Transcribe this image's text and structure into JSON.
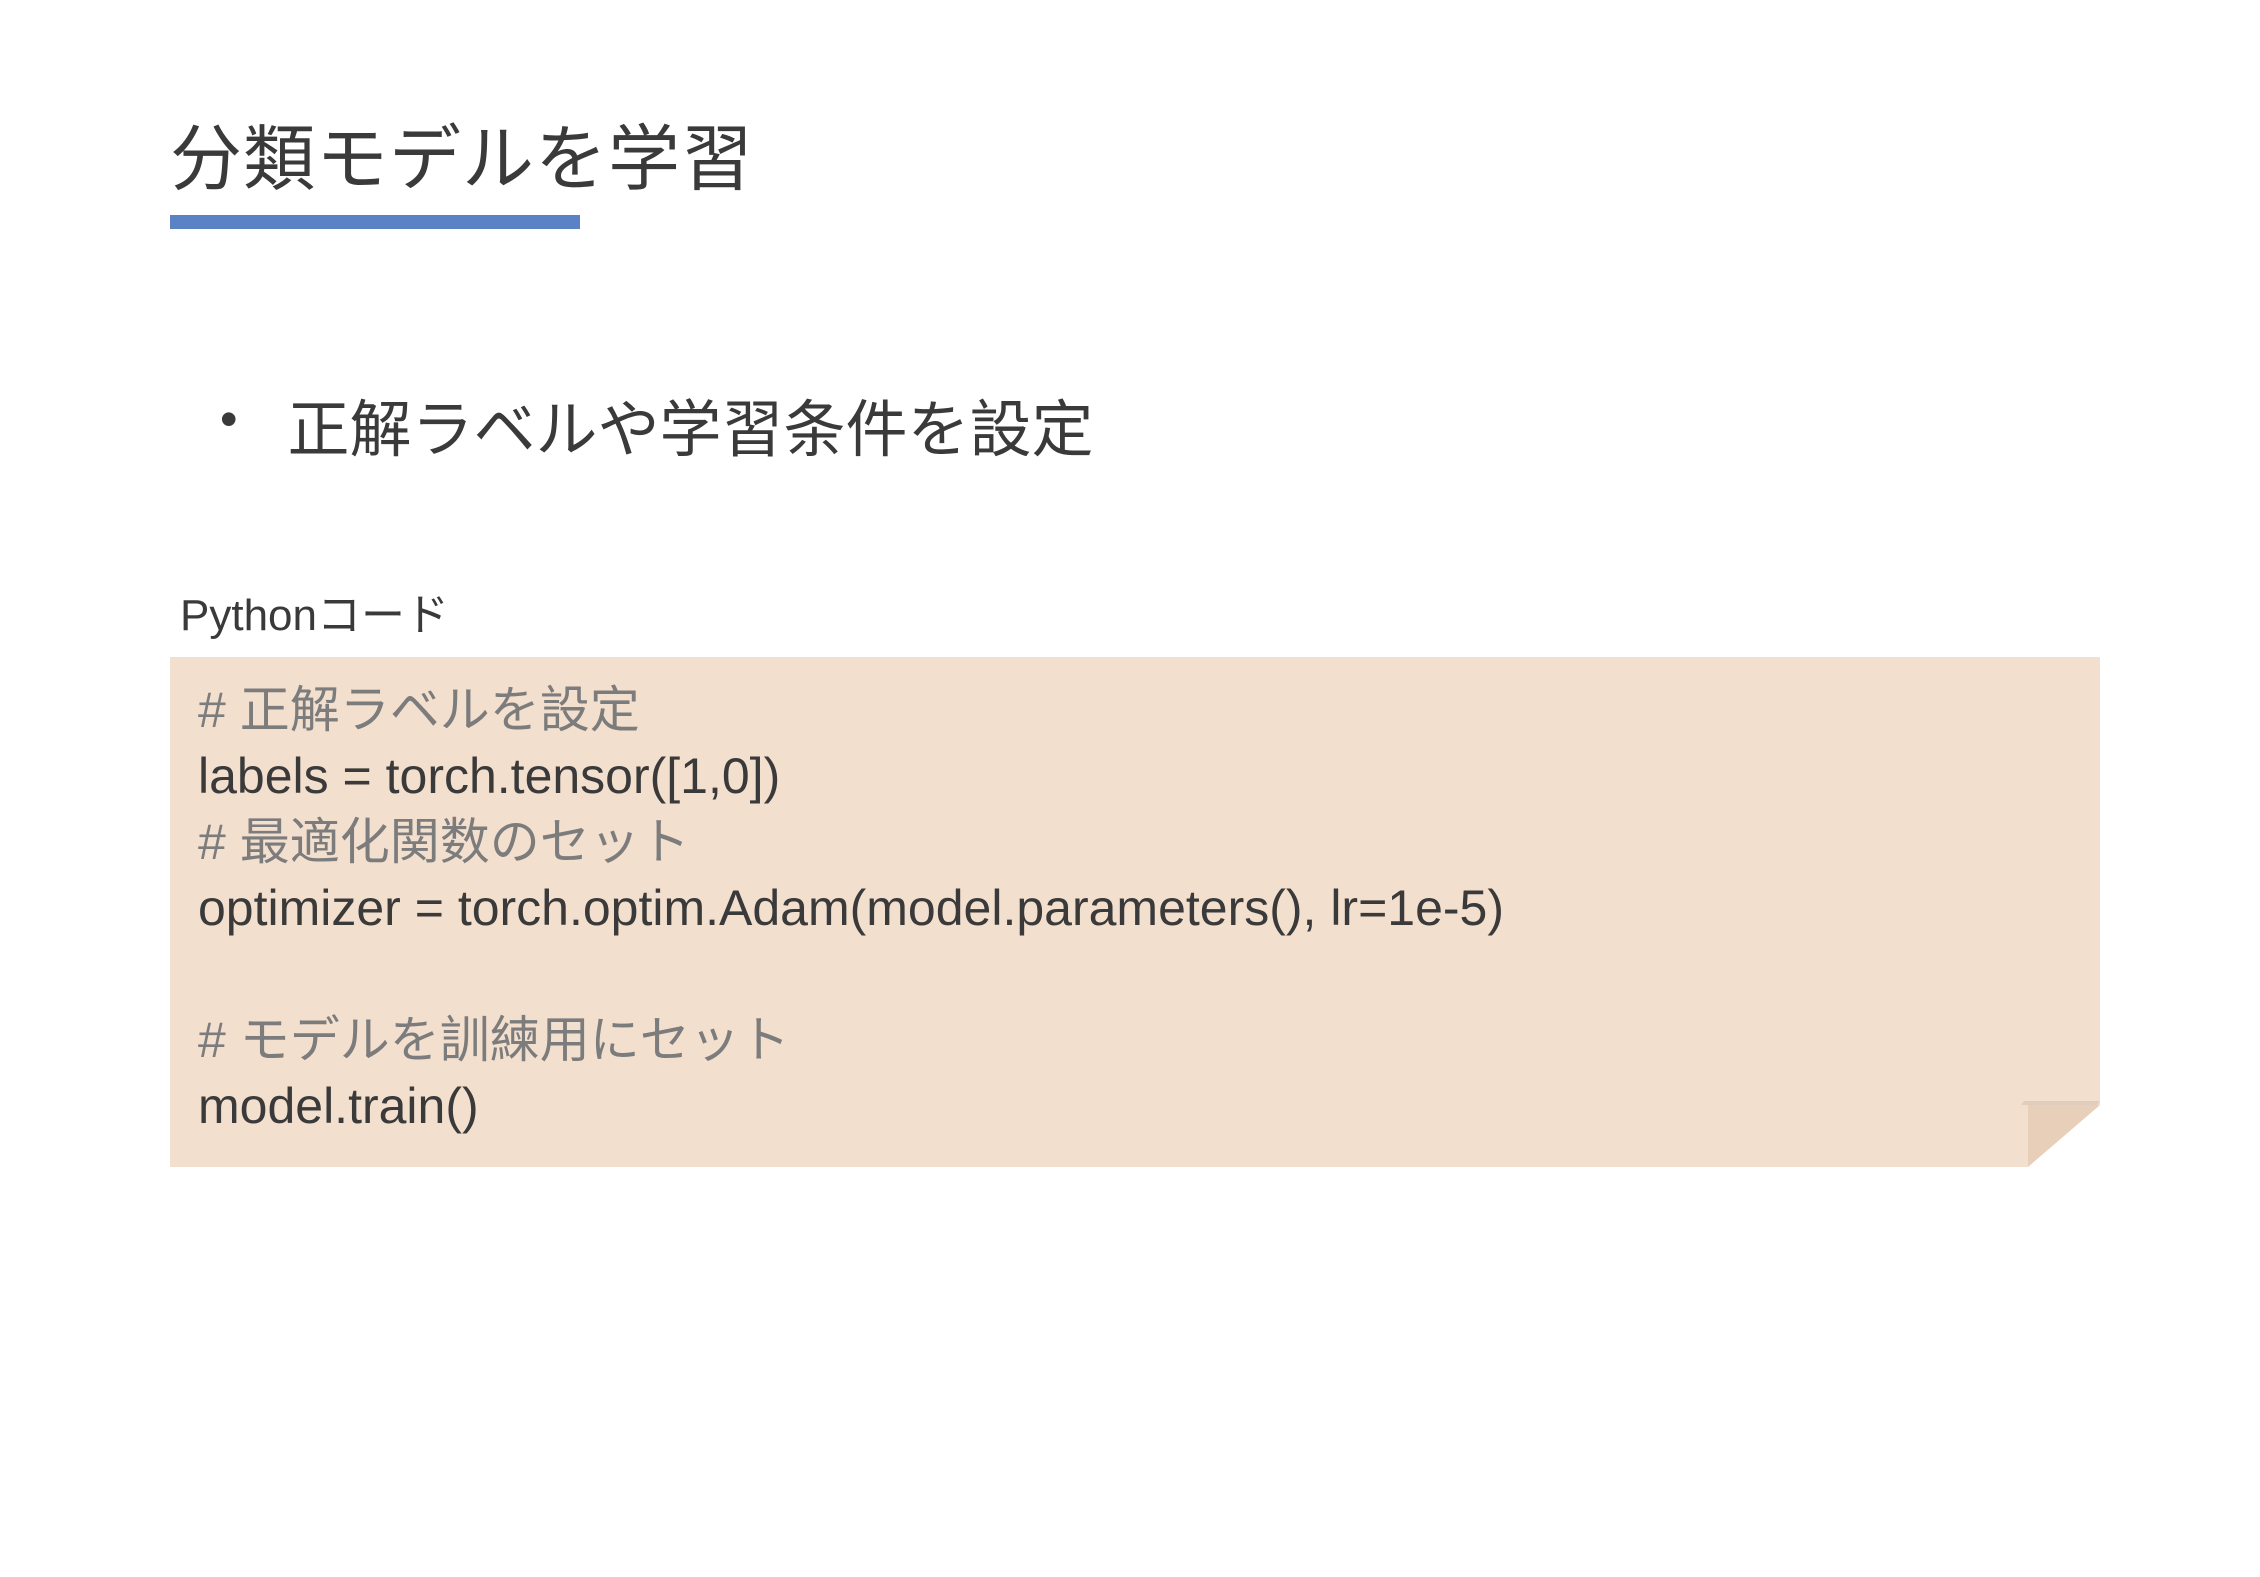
{
  "title": "分類モデルを学習",
  "bullet": "正解ラベルや学習条件を設定",
  "code_label": "Pythonコード",
  "code": {
    "c1": "# 正解ラベルを設定",
    "l1": "labels = torch.tensor([1,0])",
    "c2": "# 最適化関数のセット",
    "l2": "optimizer = torch.optim.Adam(model.parameters(), lr=1e-5)",
    "c3": "# モデルを訓練用にセット",
    "l3": "model.train()"
  }
}
